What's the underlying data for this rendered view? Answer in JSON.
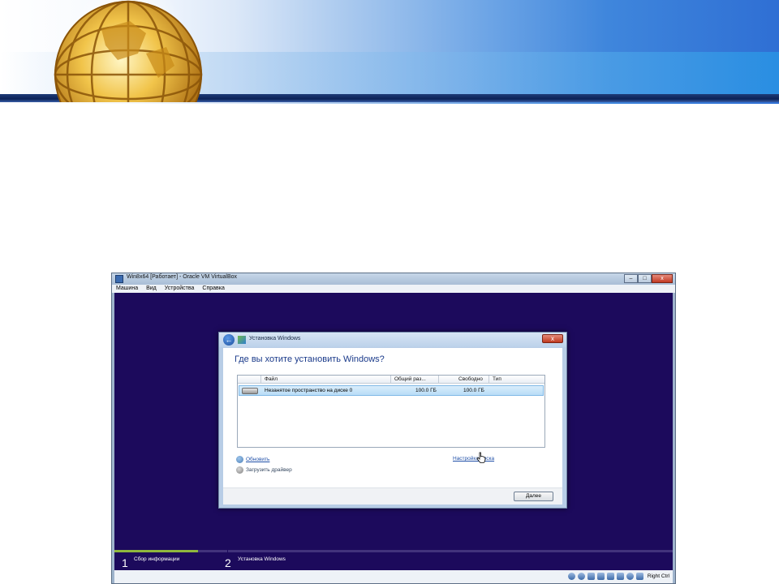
{
  "window": {
    "title": "Win8x64 [Работает] - Oracle VM VirtualBox",
    "buttons": {
      "minimize": "–",
      "maximize": "□",
      "close": "x"
    }
  },
  "menu": [
    "Машина",
    "Вид",
    "Устройства",
    "Справка"
  ],
  "dialog": {
    "title": "Установка Windows",
    "close": "x",
    "heading": "Где вы хотите установить Windows?",
    "table": {
      "columns": [
        "Файл",
        "Общий раз...",
        "Свободно",
        "Тип"
      ],
      "rows": [
        {
          "name": "Незанятое пространство на диске 0",
          "total": "100.0 ГБ",
          "free": "100.0 ГБ",
          "type": ""
        }
      ]
    },
    "links": {
      "refresh": "Обновить",
      "load_driver": "Загрузить драйвер",
      "disk_options": "Настройка диска"
    },
    "next_button": "Далее"
  },
  "progress": {
    "fill_fraction": 0.15,
    "steps": [
      {
        "number": "1",
        "label": "Сбор информации"
      },
      {
        "number": "2",
        "label": "Установка Windows"
      }
    ]
  },
  "statusbar": {
    "host_key": "Right Ctrl"
  },
  "colors": {
    "guest_bg": "#1c0a5c",
    "progress_fill": "#8fb73e",
    "link": "#2050a8"
  },
  "icons": [
    "globe-logo",
    "back-arrow-icon",
    "setup-icon",
    "disk-icon",
    "refresh-icon",
    "load-driver-icon",
    "hand-cursor-icon"
  ]
}
